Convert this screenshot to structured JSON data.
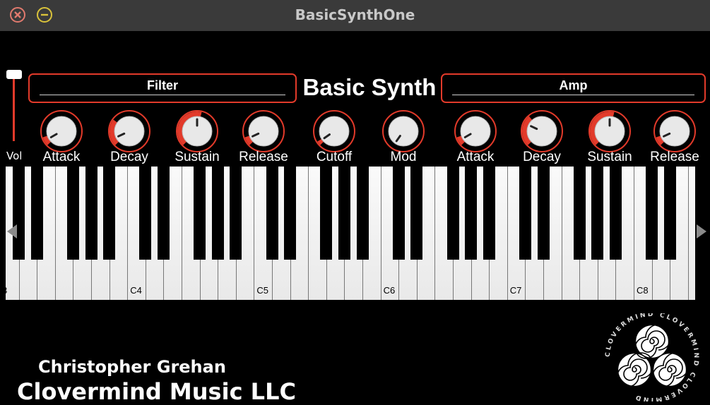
{
  "window": {
    "title": "BasicSynthOne"
  },
  "volume": {
    "label": "Vol"
  },
  "filter_section": {
    "label": "Filter"
  },
  "amp_section": {
    "label": "Amp"
  },
  "synth_title": "Basic Synth",
  "knobs": [
    {
      "label": "Attack"
    },
    {
      "label": "Decay"
    },
    {
      "label": "Sustain"
    },
    {
      "label": "Release"
    },
    {
      "label": "Cutoff"
    },
    {
      "label": "Mod"
    },
    {
      "label": "Attack"
    },
    {
      "label": "Decay"
    },
    {
      "label": "Sustain"
    },
    {
      "label": "Release"
    }
  ],
  "keyboard": {
    "partial_label": "3",
    "octave_labels": [
      "C4",
      "C5",
      "C6",
      "C7",
      "C8"
    ]
  },
  "credits": {
    "name": "Christopher Grehan",
    "company": "Clovermind Music LLC"
  },
  "logo": {
    "ring_text": "CLOVERMIND CLOVERMIND CLOVERMIND"
  },
  "colors": {
    "accent": "#e23a2a",
    "background": "#000000",
    "titlebar": "#3a3a3a",
    "close": "#e07a6e",
    "minimize": "#d9c23a"
  }
}
